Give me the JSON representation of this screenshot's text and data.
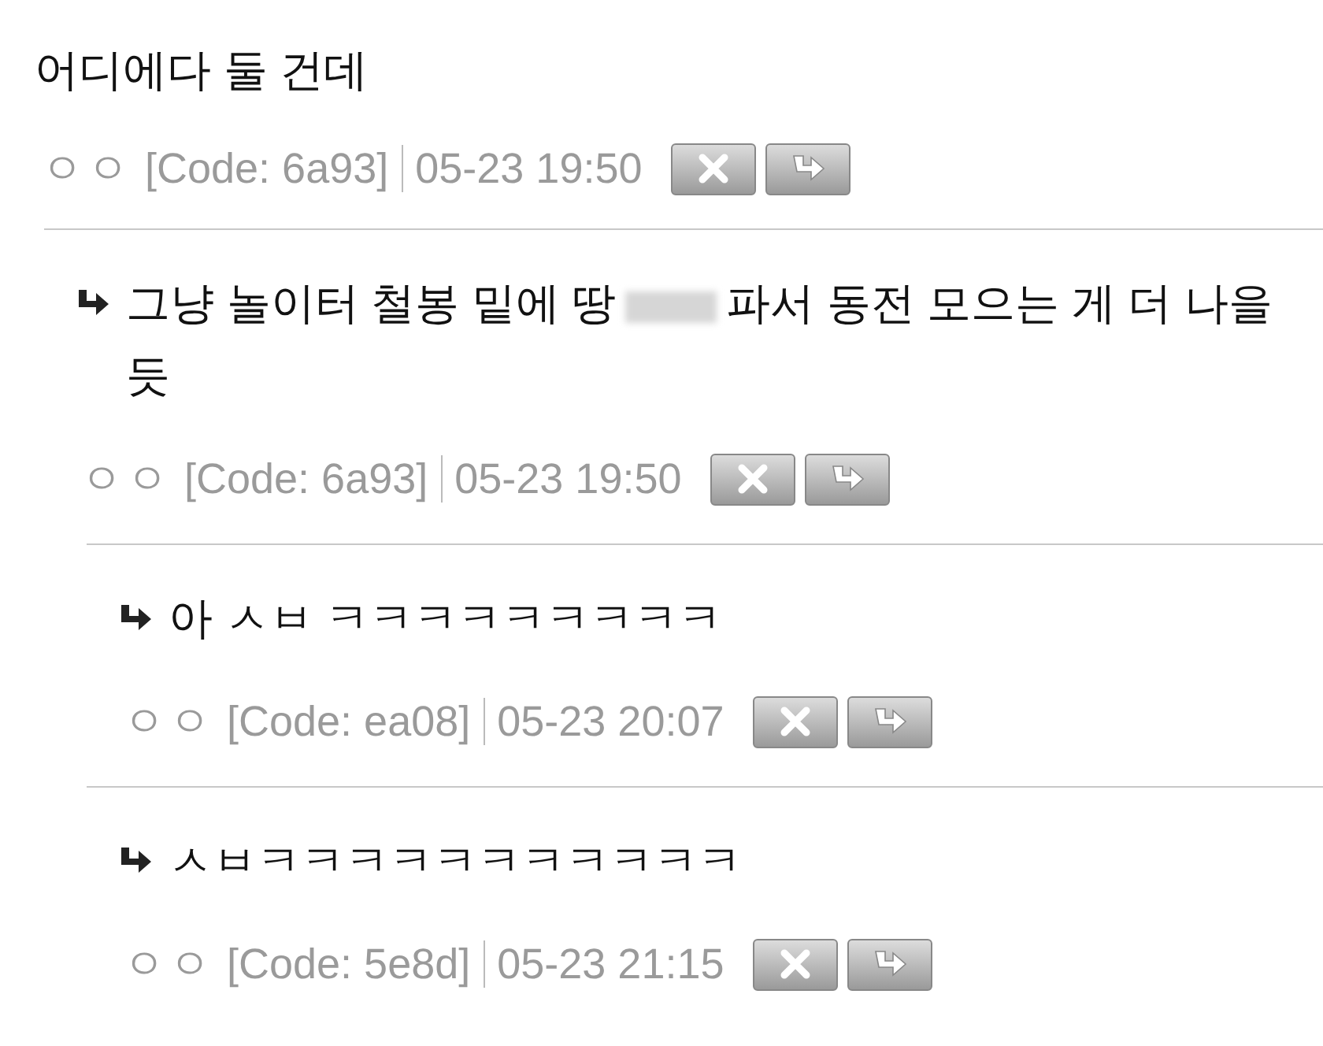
{
  "comments": [
    {
      "text": "어디에다 둘 건데",
      "author": "ㅇㅇ",
      "code": "[Code: 6a93]",
      "date": "05-23 19:50",
      "children": [
        {
          "text": "그냥 놀이터 철봉 밑에 땅",
          "redacted": true,
          "text_after": [
            "파서 동전 모으는 게 더 나을",
            "듯"
          ],
          "author": "ㅇㅇ",
          "code": "[Code: 6a93]",
          "date": "05-23 19:50",
          "children": [
            {
              "text": "아 ㅅㅂ ㅋㅋㅋㅋㅋㅋㅋㅋㅋ",
              "author": "ㅇㅇ",
              "code": "[Code: ea08]",
              "date": "05-23 20:07"
            },
            {
              "text": "ㅅㅂㅋㅋㅋㅋㅋㅋㅋㅋㅋㅋㅋ",
              "author": "ㅇㅇ",
              "code": "[Code: 5e8d]",
              "date": "05-23 21:15"
            }
          ]
        }
      ]
    }
  ]
}
